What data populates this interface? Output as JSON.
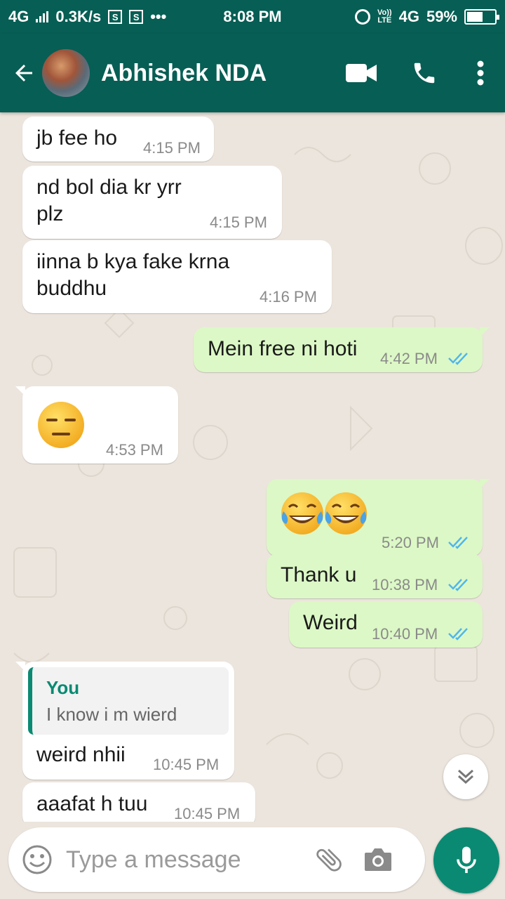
{
  "status_bar": {
    "network": "4G",
    "speed": "0.3K/s",
    "dots": "•••",
    "time": "8:08 PM",
    "volte": "Vo)) LTE",
    "network_right": "4G",
    "battery": "59%",
    "battery_level": 0.59
  },
  "header": {
    "contact_name": "Abhishek NDA",
    "icons": [
      "back-arrow-icon",
      "video-call-icon",
      "phone-icon",
      "more-vert-icon"
    ]
  },
  "messages": [
    {
      "direction": "in",
      "text": "jb fee ho",
      "time": "4:15 PM"
    },
    {
      "direction": "in",
      "text": "nd bol dia kr yrr",
      "text2": "plz",
      "time": "4:15 PM"
    },
    {
      "direction": "in",
      "text": "iinna b kya fake krna",
      "text2": "buddhu",
      "time": "4:16 PM"
    },
    {
      "direction": "out",
      "text": "Mein free ni hoti",
      "time": "4:42 PM",
      "read": true
    },
    {
      "direction": "in",
      "emoji": "expressionless-face",
      "time": "4:53 PM"
    },
    {
      "direction": "out",
      "emoji": "tears-of-joy-face x2",
      "time": "5:20 PM",
      "read": true
    },
    {
      "direction": "out",
      "text": "Thank u",
      "time": "10:38 PM",
      "read": true
    },
    {
      "direction": "out",
      "text": "Weird",
      "time": "10:40 PM",
      "read": true
    },
    {
      "direction": "in",
      "reply_to": {
        "author": "You",
        "text": "I know i m wierd"
      },
      "text": "weird nhii",
      "time": "10:45 PM"
    },
    {
      "direction": "in",
      "text": "aaafat h tuu",
      "time": "10:45 PM"
    }
  ],
  "input": {
    "placeholder": "Type a message"
  },
  "colors": {
    "header": "#075e54",
    "incoming": "#ffffff",
    "outgoing": "#dcf8c6",
    "accent": "#0a8a73",
    "read_ticks": "#4fb6ec"
  }
}
